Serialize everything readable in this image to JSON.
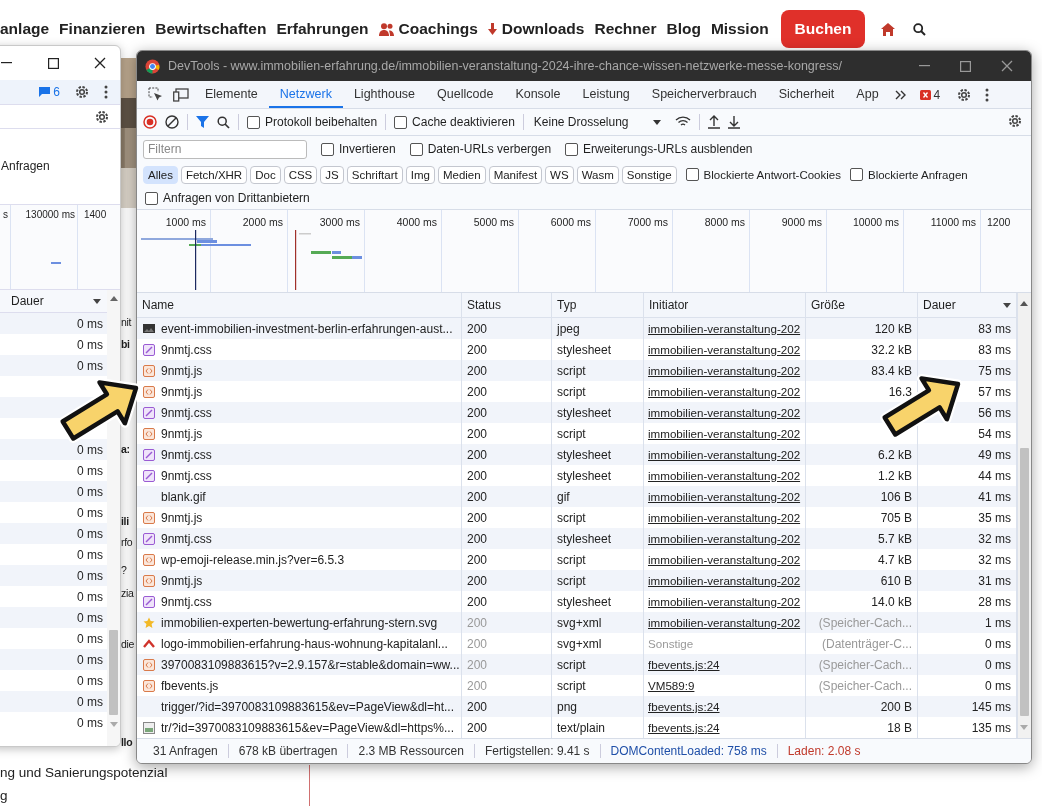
{
  "page": {
    "nav": [
      {
        "label": "anlage",
        "kind": "plain"
      },
      {
        "label": "Finanzieren",
        "kind": "plain"
      },
      {
        "label": "Bewirtschaften",
        "kind": "plain"
      },
      {
        "label": "Erfahrungen",
        "kind": "plain"
      },
      {
        "label": "Coachings",
        "kind": "group"
      },
      {
        "label": "Downloads",
        "kind": "fetch"
      },
      {
        "label": "Rechner",
        "kind": "plain"
      },
      {
        "label": "Blog",
        "kind": "plain"
      },
      {
        "label": "Mission",
        "kind": "plain"
      }
    ],
    "book_button": "Buchen",
    "fragments": [
      {
        "text": "nit",
        "kind": "plain"
      },
      {
        "text": "bi",
        "kind": "bold"
      },
      {
        "text": "a:",
        "kind": "bold"
      },
      {
        "text": "ili",
        "kind": "bold"
      },
      {
        "text": "rfo",
        "kind": "plain"
      },
      {
        "text": "?",
        "kind": "plain"
      },
      {
        "text": "zia",
        "kind": "plain"
      },
      {
        "text": "die",
        "kind": "plain"
      },
      {
        "text": "llo",
        "kind": "bold"
      }
    ],
    "footer_lines": [
      "ng und Sanierungspotenzial",
      "g"
    ]
  },
  "back_window": {
    "message_count": "6",
    "requests_label": "Anfragen",
    "timeline_ticks": [
      "s",
      "130000 ms",
      "1400"
    ],
    "column": "Dauer",
    "rows": [
      {
        "duration": "0 ms"
      },
      {
        "duration": "0 ms"
      },
      {
        "duration": "0 ms"
      },
      {},
      {},
      {},
      {
        "duration": "0 ms"
      },
      {
        "duration": "0 ms"
      },
      {
        "duration": "0 ms"
      },
      {
        "duration": "0 ms"
      },
      {
        "duration": "0 ms"
      },
      {
        "duration": "0 ms"
      },
      {
        "duration": "0 ms"
      },
      {
        "duration": "0 ms"
      },
      {
        "duration": "0 ms"
      },
      {
        "duration": "0 ms"
      },
      {
        "duration": "0 ms"
      },
      {
        "duration": "0 ms"
      },
      {
        "duration": "0 ms"
      },
      {
        "duration": "0 ms"
      }
    ]
  },
  "devtools": {
    "title": "DevTools - www.immobilien-erfahrung.de/immobilien-veranstaltung-2024-ihre-chance-wissen-netzwerke-messe-kongress/",
    "tabs": [
      {
        "label": "Elemente",
        "selected": false
      },
      {
        "label": "Netzwerk",
        "selected": true
      },
      {
        "label": "Lighthouse",
        "selected": false
      },
      {
        "label": "Quellcode",
        "selected": false
      },
      {
        "label": "Konsole",
        "selected": false
      },
      {
        "label": "Leistung",
        "selected": false
      },
      {
        "label": "Speicherverbrauch",
        "selected": false
      },
      {
        "label": "Sicherheit",
        "selected": false
      },
      {
        "label": "App",
        "selected": false
      }
    ],
    "error_count": "4",
    "toolbar_checkboxes": [
      {
        "label": "Protokoll beibehalten",
        "checked": false
      },
      {
        "label": "Cache deaktivieren",
        "checked": false
      }
    ],
    "throttling": "Keine Drosselung",
    "filter_placeholder": "Filtern",
    "filter_checkboxes": [
      {
        "label": "Invertieren",
        "checked": false
      },
      {
        "label": "Daten-URLs verbergen",
        "checked": false
      },
      {
        "label": "Erweiterungs-URLs ausblenden",
        "checked": false
      }
    ],
    "type_filters": [
      {
        "label": "Alles",
        "selected": true
      },
      {
        "label": "Fetch/XHR",
        "selected": false
      },
      {
        "label": "Doc",
        "selected": false
      },
      {
        "label": "CSS",
        "selected": false
      },
      {
        "label": "JS",
        "selected": false
      },
      {
        "label": "Schriftart",
        "selected": false
      },
      {
        "label": "Img",
        "selected": false
      },
      {
        "label": "Medien",
        "selected": false
      },
      {
        "label": "Manifest",
        "selected": false
      },
      {
        "label": "WS",
        "selected": false
      },
      {
        "label": "Wasm",
        "selected": false
      },
      {
        "label": "Sonstige",
        "selected": false
      }
    ],
    "type_checkboxes": [
      {
        "label": "Blockierte Antwort-Cookies",
        "checked": false
      },
      {
        "label": "Blockierte Anfragen",
        "checked": false
      }
    ],
    "third_party": {
      "label": "Anfragen von Drittanbietern",
      "checked": false
    },
    "overview_ticks": [
      "1000 ms",
      "2000 ms",
      "3000 ms",
      "4000 ms",
      "5000 ms",
      "6000 ms",
      "7000 ms",
      "8000 ms",
      "9000 ms",
      "10000 ms",
      "11000 ms",
      "1200"
    ],
    "columns": [
      "Name",
      "Status",
      "Typ",
      "Initiator",
      "Größe",
      "Dauer"
    ],
    "rows": [
      {
        "name": "event-immobilien-investment-berlin-erfahrungen-aust...",
        "status": "200",
        "type": "jpeg",
        "initiator": "immobilien-veranstaltung-202",
        "initiator_link": true,
        "size": "120 kB",
        "time": "83 ms",
        "cached": false
      },
      {
        "kind": "css",
        "name": "9nmtj.css",
        "status": "200",
        "type": "stylesheet",
        "initiator": "immobilien-veranstaltung-202",
        "initiator_link": true,
        "size": "32.2 kB",
        "time": "83 ms",
        "cached": false
      },
      {
        "kind": "js",
        "name": "9nmtj.js",
        "status": "200",
        "type": "script",
        "initiator": "immobilien-veranstaltung-202",
        "initiator_link": true,
        "size": "83.4 kB",
        "time": "75 ms",
        "cached": false
      },
      {
        "kind": "js",
        "name": "9nmtj.js",
        "status": "200",
        "type": "script",
        "initiator": "immobilien-veranstaltung-202",
        "initiator_link": true,
        "size": "16.3",
        "time": "57 ms",
        "cached": false
      },
      {
        "kind": "css",
        "name": "9nmtj.css",
        "status": "200",
        "type": "stylesheet",
        "initiator": "immobilien-veranstaltung-202",
        "initiator_link": true,
        "time": "56 ms",
        "cached": false
      },
      {
        "kind": "js",
        "name": "9nmtj.js",
        "status": "200",
        "type": "script",
        "initiator": "immobilien-veranstaltung-202",
        "initiator_link": true,
        "time": "54 ms",
        "cached": false
      },
      {
        "kind": "css",
        "name": "9nmtj.css",
        "status": "200",
        "type": "stylesheet",
        "initiator": "immobilien-veranstaltung-202",
        "initiator_link": true,
        "size": "6.2 kB",
        "time": "49 ms",
        "cached": false
      },
      {
        "kind": "css",
        "name": "9nmtj.css",
        "status": "200",
        "type": "stylesheet",
        "initiator": "immobilien-veranstaltung-202",
        "initiator_link": true,
        "size": "1.2 kB",
        "time": "44 ms",
        "cached": false
      },
      {
        "kind": "blank",
        "name": "blank.gif",
        "status": "200",
        "type": "gif",
        "initiator": "immobilien-veranstaltung-202",
        "initiator_link": true,
        "size": "106 B",
        "time": "41 ms",
        "cached": false
      },
      {
        "kind": "js",
        "name": "9nmtj.js",
        "status": "200",
        "type": "script",
        "initiator": "immobilien-veranstaltung-202",
        "initiator_link": true,
        "size": "705 B",
        "time": "35 ms",
        "cached": false
      },
      {
        "kind": "css",
        "name": "9nmtj.css",
        "status": "200",
        "type": "stylesheet",
        "initiator": "immobilien-veranstaltung-202",
        "initiator_link": true,
        "size": "5.7 kB",
        "time": "32 ms",
        "cached": false
      },
      {
        "kind": "js",
        "name": "wp-emoji-release.min.js?ver=6.5.3",
        "status": "200",
        "type": "script",
        "initiator": "immobilien-veranstaltung-202",
        "initiator_link": true,
        "size": "4.7 kB",
        "time": "32 ms",
        "cached": false
      },
      {
        "kind": "js",
        "name": "9nmtj.js",
        "status": "200",
        "type": "script",
        "initiator": "immobilien-veranstaltung-202",
        "initiator_link": true,
        "size": "610 B",
        "time": "31 ms",
        "cached": false
      },
      {
        "kind": "css",
        "name": "9nmtj.css",
        "status": "200",
        "type": "stylesheet",
        "initiator": "immobilien-veranstaltung-202",
        "initiator_link": true,
        "size": "14.0 kB",
        "time": "28 ms",
        "cached": false
      },
      {
        "kind": "rating",
        "name": "immobilien-experten-bewertung-erfahrung-stern.svg",
        "status": "200",
        "type": "svg+xml",
        "initiator": "immobilien-veranstaltung-202",
        "initiator_link": true,
        "size": "(Speicher-Cach...",
        "time": "1 ms",
        "cached": true
      },
      {
        "kind": "brand",
        "name": "logo-immobilien-erfahrung-haus-wohnung-kapitalanl...",
        "status": "200",
        "type": "svg+xml",
        "initiator": "Sonstige",
        "initiator_link": false,
        "size": "(Datenträger-C...",
        "time": "0 ms",
        "cached": true
      },
      {
        "kind": "js",
        "name": "3970083109883615?v=2.9.157&r=stable&domain=ww...",
        "status": "200",
        "type": "script",
        "initiator": "fbevents.js:24",
        "initiator_link": true,
        "size": "(Speicher-Cach...",
        "time": "0 ms",
        "cached": true
      },
      {
        "kind": "js",
        "name": "fbevents.js",
        "status": "200",
        "type": "script",
        "initiator": "VM589:9",
        "initiator_link": true,
        "size": "(Speicher-Cach...",
        "time": "0 ms",
        "cached": true
      },
      {
        "kind": "blank",
        "name": "trigger/?id=3970083109883615&ev=PageView&dl=ht...",
        "status": "200",
        "type": "png",
        "initiator": "fbevents.js:24",
        "initiator_link": true,
        "size": "200 B",
        "time": "145 ms",
        "cached": false
      },
      {
        "kind": "doc",
        "name": "tr/?id=3970083109883615&ev=PageView&dl=https%...",
        "status": "200",
        "type": "text/plain",
        "initiator": "fbevents.js:24",
        "initiator_link": true,
        "size": "18 B",
        "time": "135 ms",
        "cached": false
      }
    ],
    "summary": [
      {
        "text": "31 Anfragen",
        "kind": "plain"
      },
      {
        "text": "678 kB übertragen",
        "kind": "plain"
      },
      {
        "text": "2.3 MB Ressourcen",
        "kind": "plain"
      },
      {
        "text": "Fertigstellen: 9.41 s",
        "kind": "plain"
      },
      {
        "text": "DOMContentLoaded: 758 ms",
        "kind": "dom"
      },
      {
        "text": "Laden: 2.08 s",
        "kind": "load"
      }
    ]
  },
  "annotations": [
    {
      "kind": "arrow"
    },
    {
      "kind": "arrow"
    }
  ]
}
